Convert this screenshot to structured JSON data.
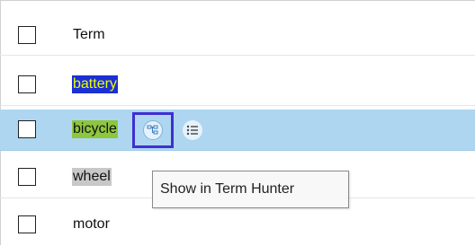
{
  "header": {
    "column_label": "Term"
  },
  "rows": [
    {
      "term": "battery",
      "highlight": "#1b2fd4",
      "text_color": "#e8ff00",
      "selected": false
    },
    {
      "term": "bicycle",
      "highlight": "#8dc63f",
      "text_color": "#111111",
      "selected": true
    },
    {
      "term": "wheel",
      "highlight": "#c8c8c8",
      "text_color": "#111111",
      "selected": false
    },
    {
      "term": "motor",
      "highlight": "",
      "text_color": "#111111",
      "selected": false
    }
  ],
  "row_actions": {
    "hunter_icon": "term-hunter-icon",
    "list_icon": "list-icon"
  },
  "tooltip": {
    "text": "Show in Term Hunter"
  },
  "colors": {
    "selected_row": "#aed6f1",
    "focus_outline": "#3f2fd0"
  }
}
